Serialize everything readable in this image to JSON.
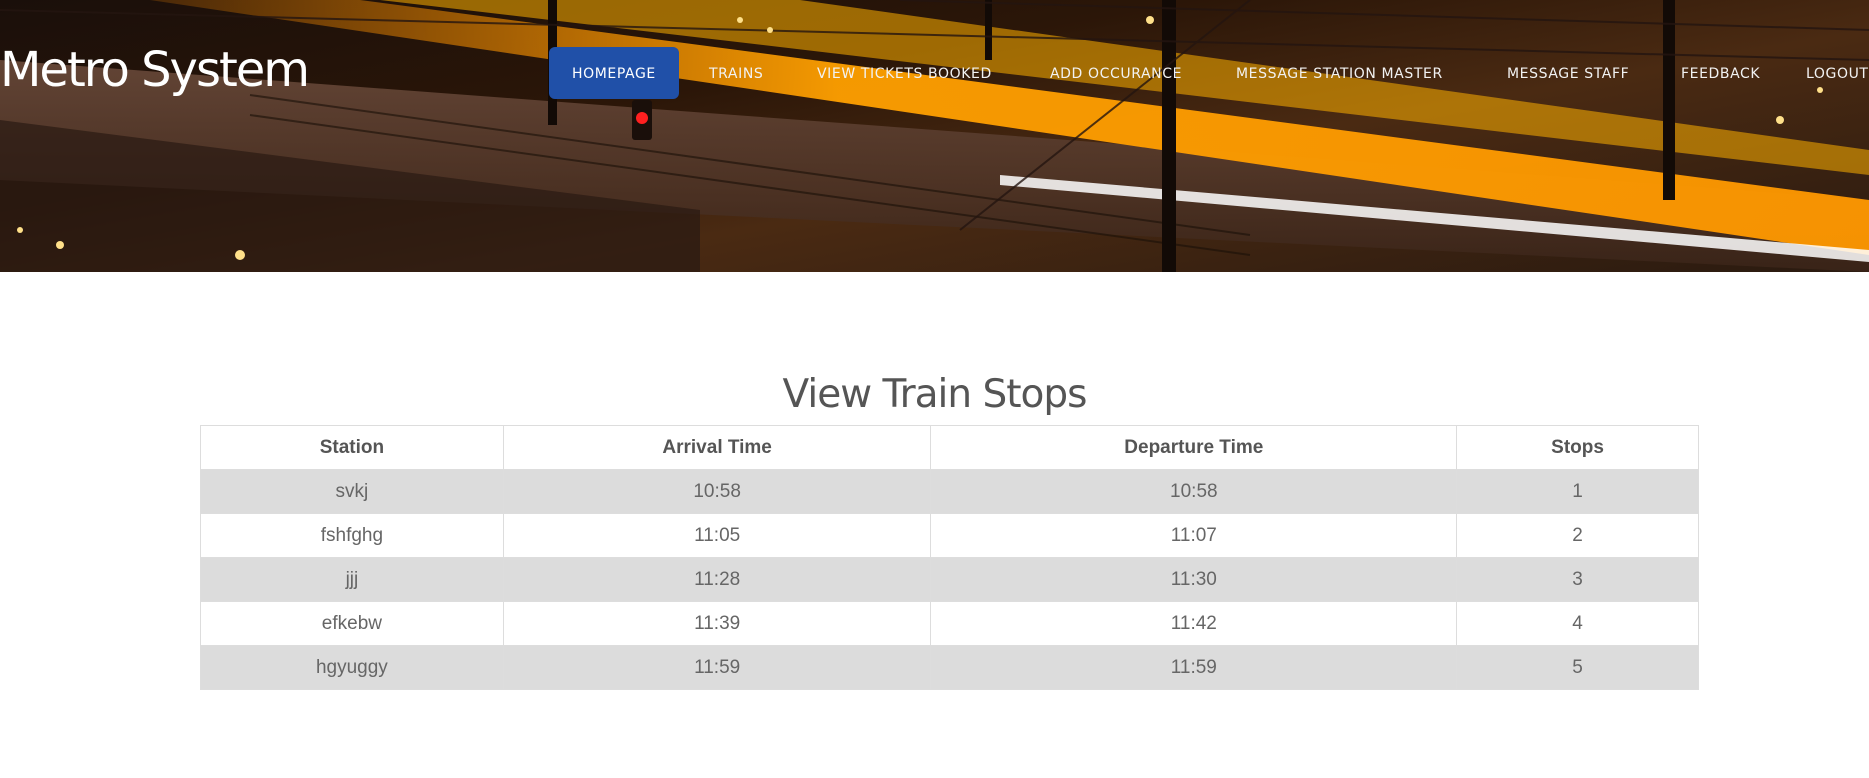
{
  "brand": {
    "title": "Metro System"
  },
  "nav": {
    "items": [
      {
        "label": "HOMEPAGE",
        "active": true
      },
      {
        "label": "TRAINS"
      },
      {
        "label": "VIEW TICKETS  BOOKED"
      },
      {
        "label": "ADD OCCURANCE"
      },
      {
        "label": "MESSAGE STATION  MASTER"
      },
      {
        "label": "MESSAGE STAFF"
      },
      {
        "label": "FEEDBACK"
      },
      {
        "label": "LOGOUT"
      }
    ]
  },
  "main": {
    "title": "View Train Stops",
    "columns": [
      "Station",
      "Arrival Time",
      "Departure Time",
      "Stops"
    ],
    "rows": [
      [
        "svkj",
        "10:58",
        "10:58",
        "1"
      ],
      [
        "fshfghg",
        "11:05",
        "11:07",
        "2"
      ],
      [
        "jjj",
        "11:28",
        "11:30",
        "3"
      ],
      [
        "efkebw",
        "11:39",
        "11:42",
        "4"
      ],
      [
        "hgyuggy",
        "11:59",
        "11:59",
        "5"
      ]
    ]
  },
  "colors": {
    "nav_active": "#2050a8",
    "row_stripe": "#dcdcdc",
    "text": "#666666"
  }
}
